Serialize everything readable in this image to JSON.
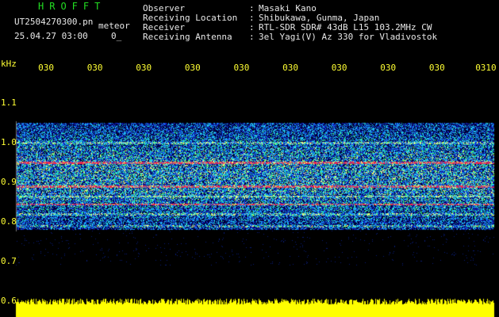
{
  "header": {
    "logo": "HROFFT",
    "file_name": "UT2504270300.pn",
    "file_type": "meteor",
    "date_time": "25.04.27 03:00",
    "counter": "0_",
    "info": [
      {
        "label": "Observer",
        "value": "Masaki Kano"
      },
      {
        "label": "Receiving Location",
        "value": "Shibukawa, Gunma, Japan"
      },
      {
        "label": "Receiver",
        "value": "RTL-SDR SDR# 43dB L15 103.2MHz CW"
      },
      {
        "label": "Receiving Antenna",
        "value": "3el Yagi(V) Az 330 for Vladivostok"
      }
    ]
  },
  "colors": {
    "background": "#000000",
    "text": "#e8e8e8",
    "axis_text": "#ffff33",
    "logo": "#22dd22",
    "signal_strip": "#ffff00",
    "echo_band": "#ff3355"
  },
  "chart_data": {
    "type": "heatmap",
    "ylabel": "kHz",
    "yticks": [
      "1.1",
      "1.0",
      "0.9",
      "0.8",
      "0.7",
      "0.6"
    ],
    "yvalues": [
      1.1,
      1.0,
      0.9,
      0.8,
      0.7,
      0.6
    ],
    "ylim": [
      0.6,
      1.12
    ],
    "xticks": [
      "030",
      "030",
      "030",
      "030",
      "030",
      "030",
      "030",
      "030",
      "030",
      "0310"
    ],
    "grid": false,
    "noise_band_khz": [
      0.78,
      1.05
    ],
    "horizontal_lines_khz": [
      1.0,
      0.95,
      0.89,
      0.865,
      0.845,
      0.82,
      0.79
    ],
    "strong_lines_khz": [
      0.95,
      0.89,
      0.845
    ]
  }
}
